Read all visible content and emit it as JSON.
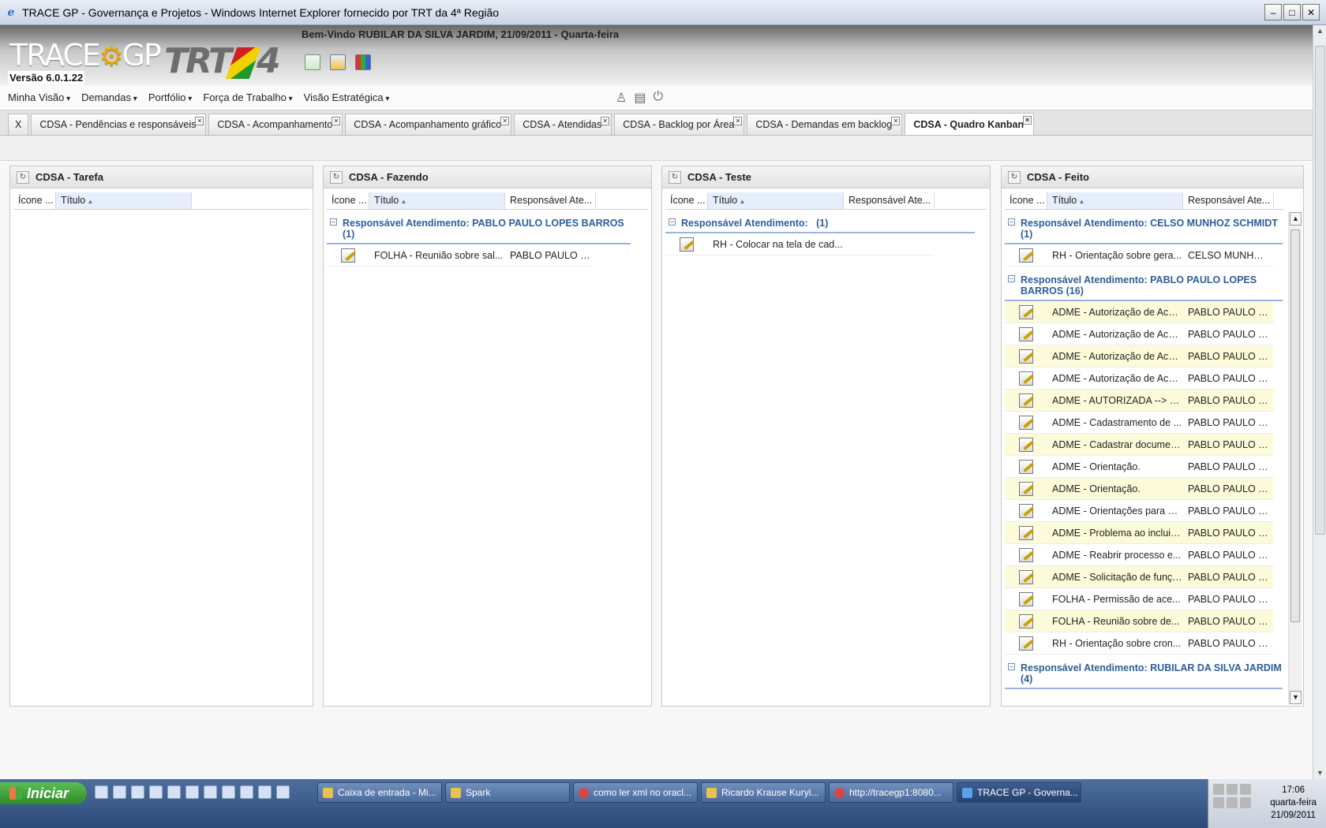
{
  "window": {
    "title": "TRACE GP - Governança e Projetos - Windows Internet Explorer fornecido por TRT da 4ª Região"
  },
  "header": {
    "logo_trace": "TRACE",
    "logo_gp": "GP",
    "logo_trt": "TRT",
    "logo_trt_num": "4",
    "version": "Versão 6.0.1.22",
    "welcome": "Bem-Vindo RUBILAR DA SILVA JARDIM, 21/09/2011 - Quarta-feira"
  },
  "menu": [
    "Minha Visão",
    "Demandas",
    "Portfólio",
    "Força de Trabalho",
    "Visão Estratégica"
  ],
  "tabs": [
    {
      "label": "X"
    },
    {
      "label": "CDSA - Pendências e responsáveis"
    },
    {
      "label": "CDSA - Acompanhamento"
    },
    {
      "label": "CDSA - Acompanhamento gráfico"
    },
    {
      "label": "CDSA - Atendidas"
    },
    {
      "label": "CDSA - Backlog por Área"
    },
    {
      "label": "CDSA - Demandas em backlog"
    },
    {
      "label": "CDSA - Quadro Kanban"
    }
  ],
  "columns": {
    "icon": "Ícone ...",
    "title": "Título",
    "resp": "Responsável Ate..."
  },
  "panels": {
    "tarefa": {
      "title": "CDSA - Tarefa"
    },
    "fazendo": {
      "title": "CDSA - Fazendo",
      "group": "Responsável Atendimento: PABLO PAULO LOPES BARROS (1)",
      "rows": [
        {
          "title": "FOLHA - Reunião sobre sal...",
          "resp": "PABLO PAULO L..."
        }
      ]
    },
    "teste": {
      "title": "CDSA - Teste",
      "group": "Responsável Atendimento:   (1)",
      "rows": [
        {
          "title": "RH - Colocar na tela de cad..."
        }
      ]
    },
    "feito": {
      "title": "CDSA - Feito",
      "group1": "Responsável Atendimento: CELSO MUNHOZ SCHMIDT (1)",
      "group1_rows": [
        {
          "title": "RH - Orientação sobre gera...",
          "resp": "CELSO MUNHOZ..."
        }
      ],
      "group2": "Responsável Atendimento: PABLO PAULO LOPES BARROS (16)",
      "group2_rows": [
        {
          "title": "ADME - Autorização de Aces...",
          "resp": "PABLO PAULO L..."
        },
        {
          "title": "ADME - Autorização de Aces...",
          "resp": "PABLO PAULO L..."
        },
        {
          "title": "ADME - Autorização de Aces...",
          "resp": "PABLO PAULO L..."
        },
        {
          "title": "ADME - Autorização de Aces...",
          "resp": "PABLO PAULO L..."
        },
        {
          "title": "ADME - AUTORIZADA --> Pr...",
          "resp": "PABLO PAULO L..."
        },
        {
          "title": "ADME - Cadastramento de ...",
          "resp": "PABLO PAULO L..."
        },
        {
          "title": "ADME - Cadastrar documen...",
          "resp": "PABLO PAULO L..."
        },
        {
          "title": "ADME - Orientação.",
          "resp": "PABLO PAULO L..."
        },
        {
          "title": "ADME - Orientação.",
          "resp": "PABLO PAULO L..."
        },
        {
          "title": "ADME - Orientações para o ...",
          "resp": "PABLO PAULO L..."
        },
        {
          "title": "ADME - Problema ao incluir ...",
          "resp": "PABLO PAULO L..."
        },
        {
          "title": "ADME - Reabrir processo e...",
          "resp": "PABLO PAULO L..."
        },
        {
          "title": "ADME - Solicitação de funçã...",
          "resp": "PABLO PAULO L..."
        },
        {
          "title": "FOLHA - Permissão de ace...",
          "resp": "PABLO PAULO L..."
        },
        {
          "title": "FOLHA - Reunião sobre de...",
          "resp": "PABLO PAULO L..."
        },
        {
          "title": "RH - Orientação sobre cron...",
          "resp": "PABLO PAULO L..."
        }
      ],
      "group3": "Responsável Atendimento: RUBILAR DA SILVA JARDIM (4)"
    }
  },
  "taskbar": {
    "start": "Iniciar",
    "tasks": [
      "Caixa de entrada - Mi...",
      "Spark",
      "como ler xml no oracl...",
      "Ricardo Krause Kuryl...",
      "http://tracegp1:8080...",
      "TRACE GP - Governa..."
    ],
    "time": "17:06",
    "day": "quarta-feira",
    "date": "21/09/2011"
  }
}
